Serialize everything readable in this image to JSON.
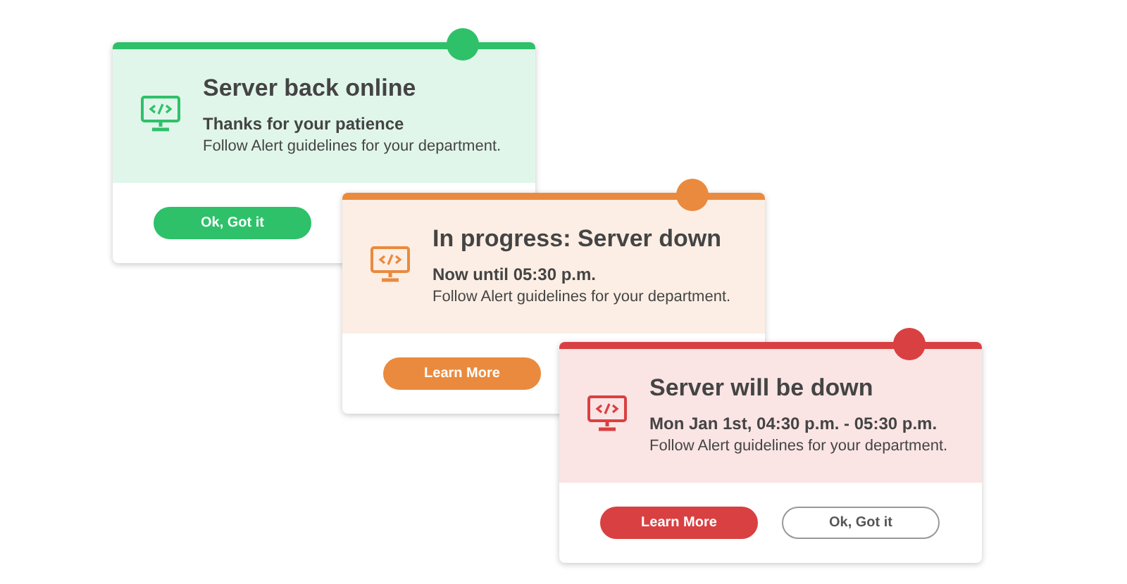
{
  "alerts": [
    {
      "color": "#2ec16a",
      "title": "Server back online",
      "subtitle": "Thanks for your patience",
      "message": "Follow Alert guidelines for your department.",
      "buttons": [
        {
          "label": "Ok, Got it",
          "kind": "primary"
        }
      ]
    },
    {
      "color": "#ea8a3e",
      "title": "In progress: Server down",
      "subtitle": "Now until 05:30 p.m.",
      "message": "Follow Alert guidelines for your department.",
      "buttons": [
        {
          "label": "Learn More",
          "kind": "primary"
        }
      ]
    },
    {
      "color": "#d94042",
      "title": "Server will be down",
      "subtitle": "Mon Jan 1st, 04:30 p.m. - 05:30 p.m.",
      "message": "Follow Alert guidelines for your department.",
      "buttons": [
        {
          "label": "Learn More",
          "kind": "primary"
        },
        {
          "label": "Ok, Got it",
          "kind": "outline"
        }
      ]
    }
  ]
}
